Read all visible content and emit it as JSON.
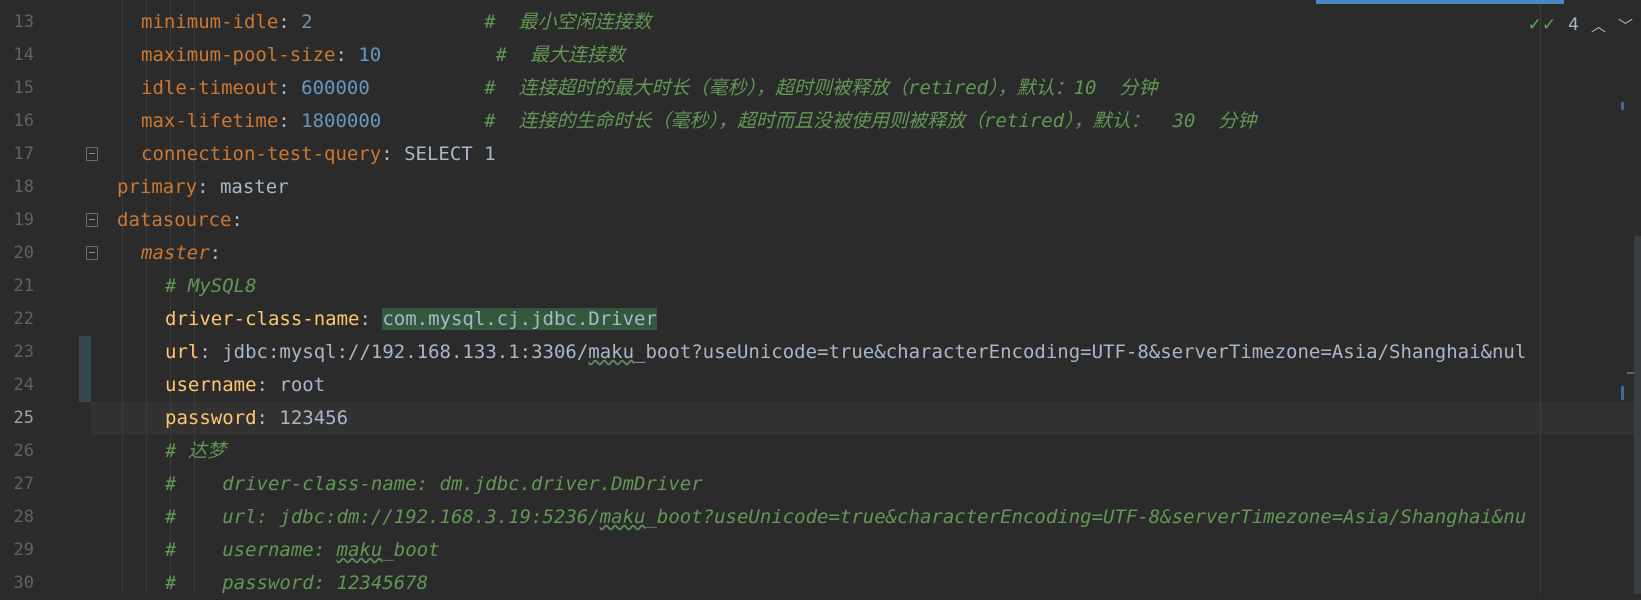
{
  "editor": {
    "current_line": 25,
    "inspections": {
      "count": "4",
      "check_icon": "check-double-icon"
    },
    "lines": [
      {
        "n": "13",
        "indent": 4,
        "parts": [
          {
            "t": "minimum-idle",
            "c": "k1"
          },
          {
            "t": ": ",
            "c": "val"
          },
          {
            "t": "2",
            "c": "num"
          },
          {
            "t": "               ",
            "c": "val"
          },
          {
            "t": "#  最小空闲连接数",
            "c": "cm"
          }
        ]
      },
      {
        "n": "14",
        "indent": 4,
        "parts": [
          {
            "t": "maximum-pool-size",
            "c": "k1"
          },
          {
            "t": ": ",
            "c": "val"
          },
          {
            "t": "10",
            "c": "num"
          },
          {
            "t": "          ",
            "c": "val"
          },
          {
            "t": "#  最大连接数",
            "c": "cm"
          }
        ]
      },
      {
        "n": "15",
        "indent": 4,
        "parts": [
          {
            "t": "idle-timeout",
            "c": "k1"
          },
          {
            "t": ": ",
            "c": "val"
          },
          {
            "t": "600000",
            "c": "num"
          },
          {
            "t": "          ",
            "c": "val"
          },
          {
            "t": "#  连接超时的最大时长（毫秒），超时则被释放（retired），默认：10  分钟",
            "c": "cm"
          }
        ]
      },
      {
        "n": "16",
        "indent": 4,
        "parts": [
          {
            "t": "max-lifetime",
            "c": "k1"
          },
          {
            "t": ": ",
            "c": "val"
          },
          {
            "t": "1800000",
            "c": "num"
          },
          {
            "t": "         ",
            "c": "val"
          },
          {
            "t": "#  连接的生命时长（毫秒），超时而且没被使用则被释放（retired），默认：  30  分钟",
            "c": "cm"
          }
        ]
      },
      {
        "n": "17",
        "indent": 4,
        "parts": [
          {
            "t": "connection-test-query",
            "c": "k1"
          },
          {
            "t": ": ",
            "c": "val"
          },
          {
            "t": "SELECT 1",
            "c": "val"
          }
        ]
      },
      {
        "n": "18",
        "indent": 2,
        "parts": [
          {
            "t": "primary",
            "c": "k1"
          },
          {
            "t": ": ",
            "c": "val"
          },
          {
            "t": "master",
            "c": "val"
          }
        ]
      },
      {
        "n": "19",
        "indent": 2,
        "parts": [
          {
            "t": "datasource",
            "c": "k1"
          },
          {
            "t": ":",
            "c": "val"
          }
        ]
      },
      {
        "n": "20",
        "indent": 4,
        "parts": [
          {
            "t": "master",
            "c": "k3"
          },
          {
            "t": ":",
            "c": "val"
          }
        ]
      },
      {
        "n": "21",
        "indent": 6,
        "parts": [
          {
            "t": "# MySQL8",
            "c": "cm"
          }
        ]
      },
      {
        "n": "22",
        "indent": 6,
        "parts": [
          {
            "t": "driver-class-name",
            "c": "k4"
          },
          {
            "t": ": ",
            "c": "val"
          },
          {
            "t": "com.mysql.cj.jdbc.Driver",
            "c": "val hl"
          }
        ]
      },
      {
        "n": "23",
        "indent": 6,
        "parts": [
          {
            "t": "url",
            "c": "k4"
          },
          {
            "t": ": ",
            "c": "val"
          },
          {
            "t": "jdbc:mysql://192.168.133.1:3306/",
            "c": "val"
          },
          {
            "t": "maku",
            "c": "val wavy"
          },
          {
            "t": "_boot?useUnicode=true&characterEncoding=UTF-8&serverTimezone=Asia/Shanghai&nul",
            "c": "val"
          }
        ]
      },
      {
        "n": "24",
        "indent": 6,
        "parts": [
          {
            "t": "username",
            "c": "k4"
          },
          {
            "t": ": ",
            "c": "val"
          },
          {
            "t": "root",
            "c": "val"
          }
        ]
      },
      {
        "n": "25",
        "indent": 6,
        "parts": [
          {
            "t": "password",
            "c": "k4"
          },
          {
            "t": ": ",
            "c": "val"
          },
          {
            "t": "123456",
            "c": "val"
          }
        ]
      },
      {
        "n": "26",
        "indent": 6,
        "parts": [
          {
            "t": "# 达梦",
            "c": "cm"
          }
        ]
      },
      {
        "n": "27",
        "indent": 6,
        "parts": [
          {
            "t": "#    driver-class-name: dm.jdbc.driver.DmDriver",
            "c": "cm"
          }
        ]
      },
      {
        "n": "28",
        "indent": 6,
        "parts": [
          {
            "t": "#    url: jdbc:dm://192.168.3.19:5236/",
            "c": "cm"
          },
          {
            "t": "maku",
            "c": "cm wavy"
          },
          {
            "t": "_boot?useUnicode=true&characterEncoding=UTF-8&serverTimezone=Asia/Shanghai&nu",
            "c": "cm"
          }
        ]
      },
      {
        "n": "29",
        "indent": 6,
        "parts": [
          {
            "t": "#    username: ",
            "c": "cm"
          },
          {
            "t": "maku",
            "c": "cm wavy"
          },
          {
            "t": "_boot",
            "c": "cm"
          }
        ]
      },
      {
        "n": "30",
        "indent": 6,
        "parts": [
          {
            "t": "#    password: 12345678",
            "c": "cm"
          }
        ]
      }
    ]
  }
}
